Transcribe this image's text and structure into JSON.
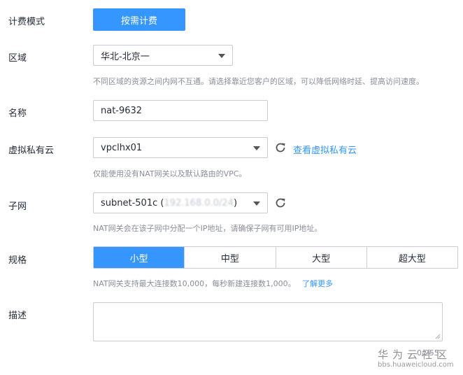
{
  "billing": {
    "label": "计费模式",
    "button": "按需计费"
  },
  "region": {
    "label": "区域",
    "value": "华北-北京一",
    "hint": "不同区域的资源之间内网不互通。请选择靠近您客户的区域，可以降低网络时延、提高访问速度。"
  },
  "name": {
    "label": "名称",
    "value": "nat-9632"
  },
  "vpc": {
    "label": "虚拟私有云",
    "value": "vpclhx01",
    "link": "查看虚拟私有云",
    "hint": "仅能使用没有NAT网关以及默认路由的VPC。"
  },
  "subnet": {
    "label": "子网",
    "value_prefix": "subnet-501c (",
    "value_blurred": "192.168.0.0/24",
    "value_suffix": ")",
    "hint": "NAT网关会在该子网中分配一个IP地址，请确保子网有可用IP地址。"
  },
  "spec": {
    "label": "规格",
    "options": [
      "小型",
      "中型",
      "大型",
      "超大型"
    ],
    "selected": "小型",
    "hint": "NAT网关支持最大连接数10,000，每秒新建连接数1,000。",
    "link": "了解更多"
  },
  "description": {
    "label": "描述",
    "value": ""
  },
  "watermark": {
    "brand": "华为云社区",
    "url": "bbs.huaweicloud.com",
    "counter": "0/255"
  },
  "colors": {
    "primary": "#3596ff",
    "border": "#c9ccd3",
    "hint": "#8a8e99"
  },
  "icons": {
    "refresh": "refresh-icon",
    "dropdown": "chevron-down-icon"
  }
}
